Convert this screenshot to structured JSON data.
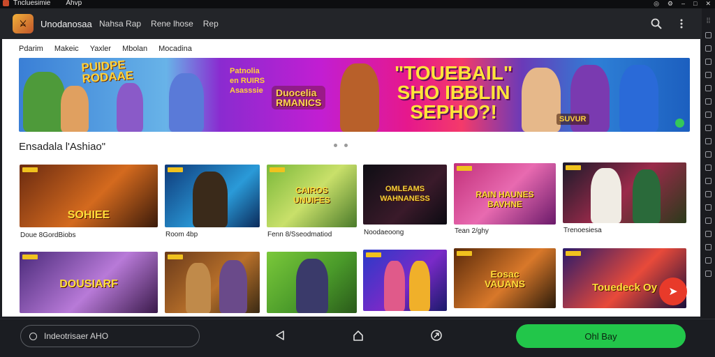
{
  "window": {
    "title": "Tncluesimie",
    "subtitle": "Ahvp"
  },
  "appbar": {
    "logo_text": "⚔",
    "app_name": "Unodanosaa",
    "nav": [
      "Nahsa Rap",
      "Rene lhose",
      "Rep"
    ]
  },
  "panel": {
    "tabs": [
      "Pdarim",
      "Makeic",
      "Yaxler",
      "Mbolan",
      "Mocadina"
    ],
    "banner": {
      "left_title": "PUIDPE\nRODAAE",
      "small_text": "Patnolia\nen RUIRS\nAsasssie",
      "badge": "Duocelia\nRMANICS",
      "headline": "\"TOUEBAIL\"\nSHO IBBLIN\nSEPHO?!",
      "right_badge": "SUVUR"
    },
    "section_title": "Ensadala l'Ashiao\"",
    "row1": [
      {
        "title": "SOHIEE",
        "caption": "Doue 8GordBiobs",
        "bg": "linear-gradient(135deg,#6a2a10,#d46a1e 55%,#3a1a0a)"
      },
      {
        "title": "",
        "caption": "Room 4bp",
        "bg": "linear-gradient(135deg,#0f3a7a,#2a9ad8 60%,#0b2a5a)"
      },
      {
        "title": "CAIROS\nUNUIFES",
        "caption": "Fenn 8/Sseodmatiod",
        "bg": "linear-gradient(135deg,#7ab83a,#c9e06a 50%,#4a7a2a)"
      },
      {
        "title": "OMLEAMS\nWAHNANESS",
        "caption": "Noodaeoong",
        "bg": "linear-gradient(135deg,#0e0e14,#3a1a2a 60%,#0b0b12)"
      },
      {
        "title": "RAIN HAUNES\nBAVHNE",
        "caption": "Tean 2/ghy",
        "bg": "linear-gradient(135deg,#c2307a,#e86ab0 50%,#6a1a6a)"
      },
      {
        "title": "",
        "caption": "Trenoesiesa",
        "bg": "linear-gradient(135deg,#1a1a2a,#9a2a4a 50%,#2a3a1a)"
      }
    ],
    "row2": [
      {
        "title": "DOUSIARF",
        "bg": "linear-gradient(135deg,#4a2a7a,#b87ad8 55%,#3a1a4a)"
      },
      {
        "title": "",
        "bg": "linear-gradient(135deg,#6a3a1a,#b8702a 55%,#3a2a14)"
      },
      {
        "title": "",
        "bg": "linear-gradient(135deg,#7ac83a,#4a9a2a 55%,#2a5a1a)"
      },
      {
        "title": "",
        "bg": "linear-gradient(135deg,#2a3ac8,#7a2ac8 55%,#1a1a6a)"
      },
      {
        "title": "Eosac\nVAUANS",
        "bg": "linear-gradient(135deg,#5a2a0a,#d8782a 55%,#2a1a0a)"
      },
      {
        "title": "Touedeck Oy",
        "bg": "linear-gradient(135deg,#2a1a6a,#e84a3a 55%,#1a0e3a)"
      }
    ]
  },
  "bottombar": {
    "search_placeholder": "Indeotrisaer AHO",
    "cta_label": "Ohl Bay"
  },
  "colors": {
    "accent_green": "#22c64a",
    "panel_bg": "#ffffff",
    "chrome_bg": "#1b1d22",
    "badge_red": "#e83a2a"
  }
}
